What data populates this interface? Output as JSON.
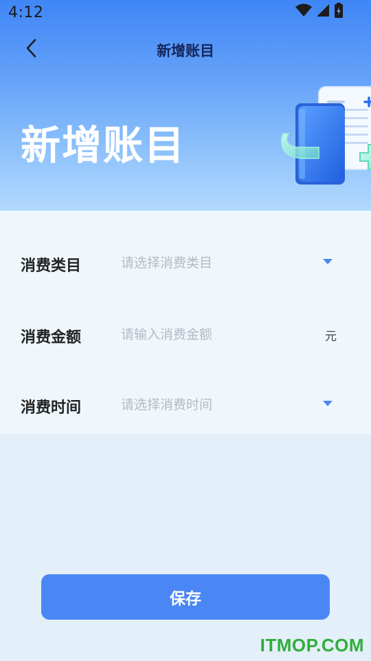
{
  "status_bar": {
    "time": "4:12",
    "icons": [
      "wifi-icon",
      "signal-icon",
      "battery-icon"
    ]
  },
  "navbar": {
    "title": "新增账目",
    "back_icon": "chevron-left-icon"
  },
  "hero": {
    "title": "新增账目",
    "illustration": "ledger-book-illustration"
  },
  "form": {
    "rows": [
      {
        "label": "消费类目",
        "placeholder": "请选择消费类目",
        "value": "",
        "trailing": "dropdown"
      },
      {
        "label": "消费金额",
        "placeholder": "请输入消费金额",
        "value": "",
        "trailing": "unit",
        "unit": "元"
      },
      {
        "label": "消费时间",
        "placeholder": "请选择消费时间",
        "value": "",
        "trailing": "dropdown"
      }
    ]
  },
  "actions": {
    "save_label": "保存"
  },
  "watermark": {
    "text": "ITMOP.COM"
  },
  "colors": {
    "primary": "#4a87f5",
    "hero_top": "#3f86f6",
    "hero_bottom": "#b3dafe",
    "form_bg": "#eff7fd",
    "page_bg": "#e3eff9",
    "watermark": "#2fae3a"
  }
}
